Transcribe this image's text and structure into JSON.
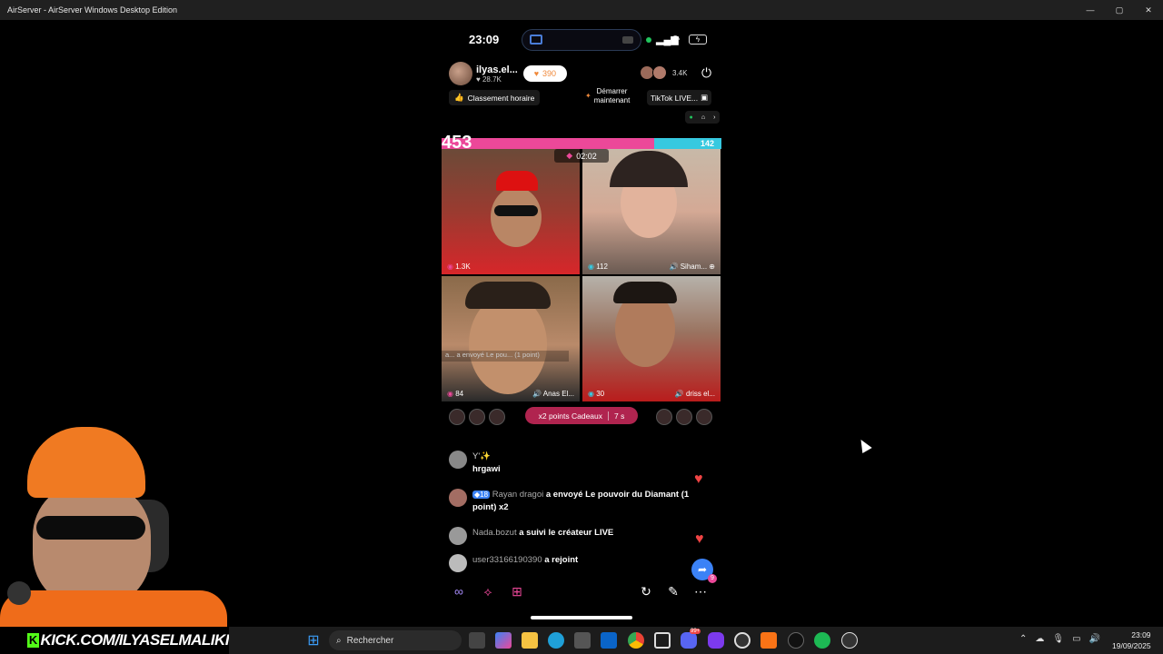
{
  "window": {
    "title": "AirServer - AirServer Windows Desktop Edition",
    "controls": [
      "—",
      "▢",
      "✕"
    ]
  },
  "phone_status": {
    "time": "23:09",
    "signal": "▂▄▆",
    "wifi": "◠",
    "battery": "ϟ"
  },
  "live": {
    "host_name": "ilyas.el...",
    "host_likes": "28.7K",
    "gift_count": "390",
    "viewer_count": "3.4K",
    "hourly_rank": "Classement horaire",
    "start_label_1": "Démarrer",
    "start_label_2": "maintenant",
    "tiktok_live": "TikTok LIVE..."
  },
  "battle": {
    "score_left": "453",
    "score_right": "142",
    "score_fraction": 0.76,
    "timer": "02:02",
    "tiles": [
      {
        "left": "1.3K",
        "right": ""
      },
      {
        "left": "112",
        "right": "Siham..."
      },
      {
        "left": "84",
        "right": "Anas El..."
      },
      {
        "left": "30",
        "right": "driss el..."
      }
    ],
    "overlay_message": "a... a envoyé Le pou... (1 point)"
  },
  "bonus": {
    "label": "x2 points Cadeaux",
    "time": "7 s"
  },
  "chat": [
    {
      "user": "Y'✨",
      "text": "hrgawi"
    },
    {
      "user": "Rayan dragoi",
      "badge": "18",
      "text": "a envoyé Le pouvoir du Diamant (1 point) x2"
    },
    {
      "user": "Nada.bozut",
      "text": "a suivi le créateur LIVE"
    },
    {
      "user": "user33166190390",
      "text": "a rejoint"
    }
  ],
  "share_badge": "9",
  "overlay": {
    "kick": "KICK.COM/ILYASELMALIKI",
    "kick_letter": "K"
  },
  "taskbar": {
    "search_placeholder": "Rechercher",
    "time": "23:09",
    "date": "19/09/2025",
    "notif_badge": "99+"
  },
  "colors": {
    "accent_pink": "#ec4899",
    "accent_cyan": "#36c9e0",
    "kick_green": "#53fc18"
  }
}
